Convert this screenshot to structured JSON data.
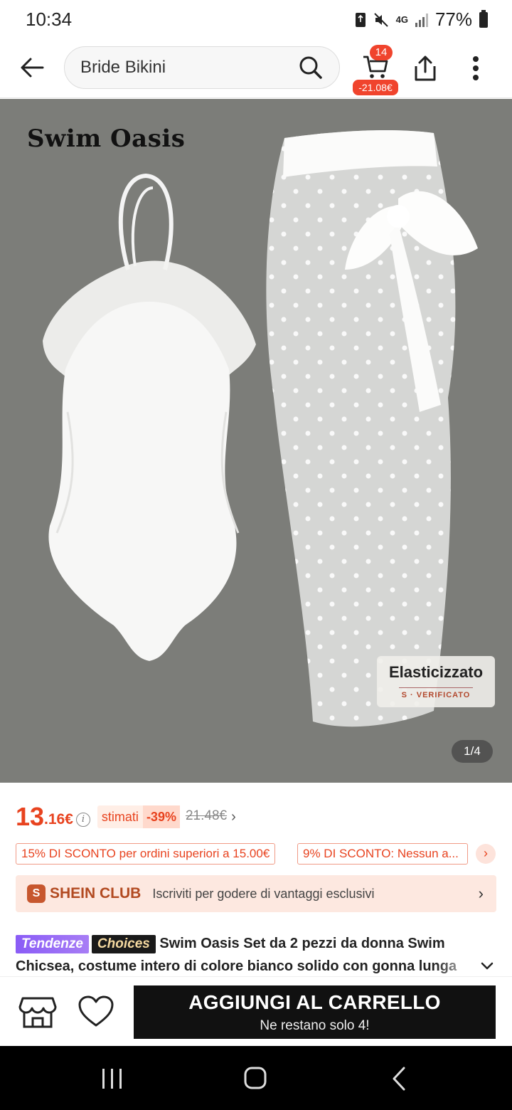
{
  "status": {
    "time": "10:34",
    "network": "4G",
    "battery": "77%"
  },
  "header": {
    "search_text": "Bride Bikini",
    "cart_count": "14",
    "cart_price": "-21.08€"
  },
  "hero": {
    "brand": "Swim Oasis",
    "badge_title": "Elasticizzato",
    "badge_sub": "S · VERIFICATO",
    "page_counter": "1/4"
  },
  "price": {
    "main": "13",
    "cents": ".16€",
    "estimate_label": "stimati",
    "discount_pct": "-39%",
    "original": "21.48€"
  },
  "coupons": [
    {
      "label": "15% DI SCONTO per ordini superiori a 15.00€"
    },
    {
      "label": "9% DI SCONTO: Nessun a..."
    }
  ],
  "club": {
    "badge": "S",
    "name": "SHEIN CLUB",
    "description": "Iscriviti per godere di vantaggi esclusivi"
  },
  "product": {
    "tag_trend": "Tendenze",
    "tag_choices": "Choices",
    "title": "Swim Oasis Set da 2 pezzi da donna Swim Chicsea, costume intero di colore bianco solido con gonna lunga"
  },
  "action_bar": {
    "add_to_cart": "AGGIUNGI AL CARRELLO",
    "stock_note": "Ne restano solo 4!"
  },
  "colors": {
    "accent": "#e8431f",
    "cart_badge": "#f0442d",
    "hero_background": "#7c7d79",
    "club_background": "#fde8e0",
    "button_dark": "#111111"
  },
  "icons": [
    "back-arrow-icon",
    "search-icon",
    "cart-icon",
    "share-icon",
    "more-vertical-icon",
    "info-icon",
    "chevron-right-icon",
    "store-icon",
    "heart-icon",
    "chevron-down-icon"
  ]
}
